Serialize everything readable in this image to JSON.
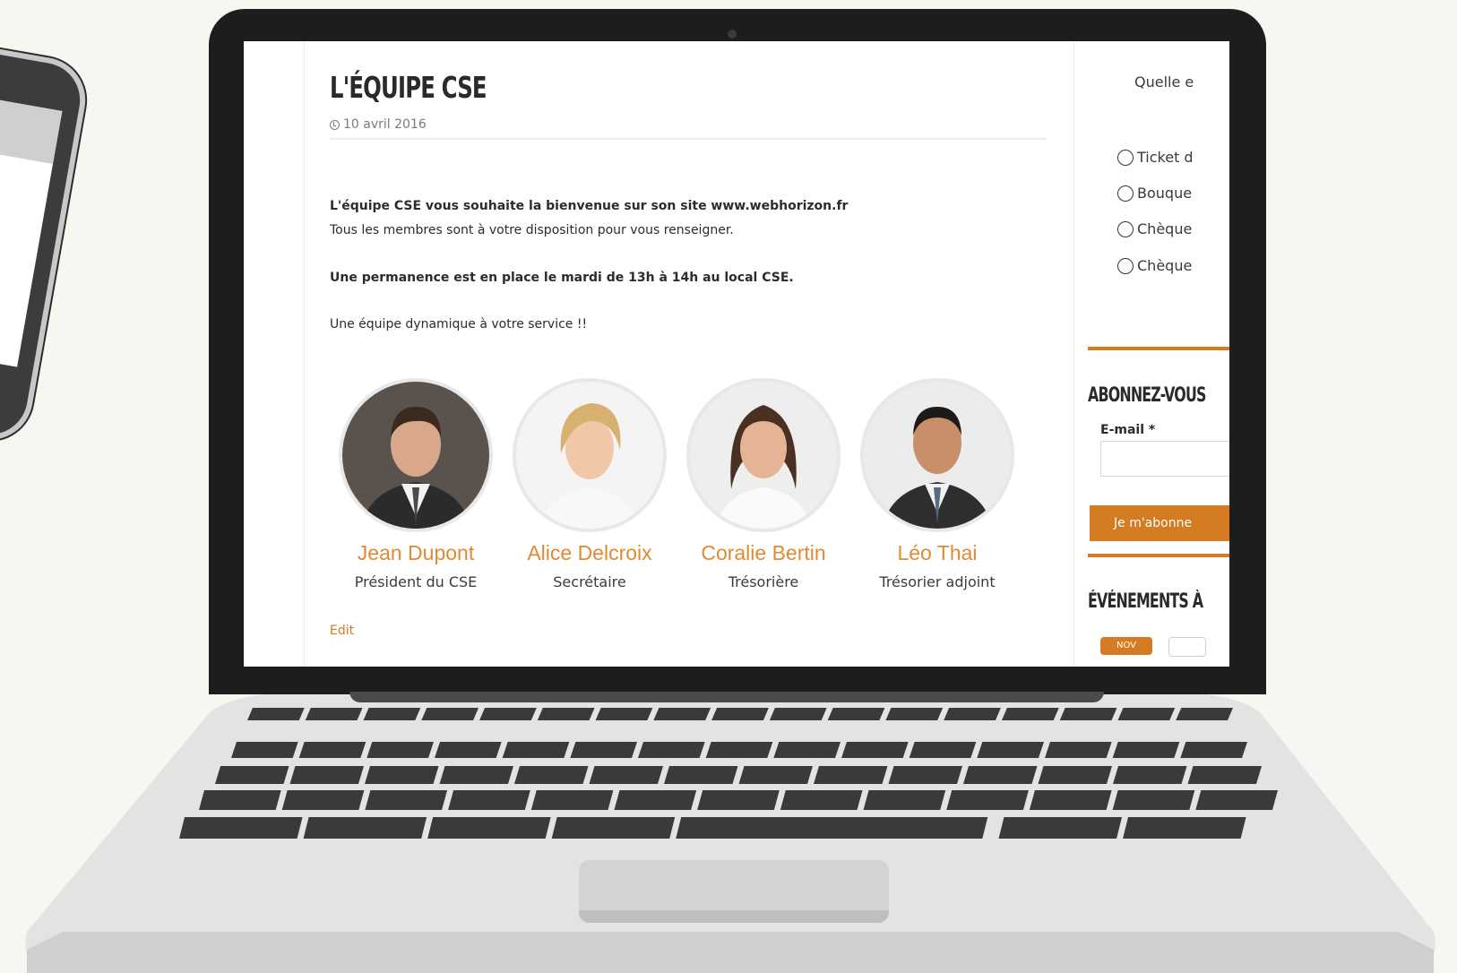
{
  "page": {
    "title": "L'ÉQUIPE CSE",
    "date": "10 avril 2016",
    "intro_bold": "L'équipe CSE vous souhaite la bienvenue sur son site www.webhorizon.fr",
    "intro_text": "Tous les membres sont à votre disposition pour vous renseigner.",
    "permanence": "Une permanence est en place le mardi de 13h à 14h au local CSE.",
    "tagline": "Une équipe dynamique à votre service !!",
    "edit_label": "Edit"
  },
  "team": [
    {
      "name": "Jean Dupont",
      "role": "Président du CSE"
    },
    {
      "name": "Alice Delcroix",
      "role": "Secrétaire"
    },
    {
      "name": "Coralie Bertin",
      "role": "Trésorière"
    },
    {
      "name": "Léo Thai",
      "role": "Trésorier adjoint"
    }
  ],
  "sidebar": {
    "poll_question": "Quelle e",
    "poll_options": [
      "Ticket d",
      "Bouque",
      "Chèque",
      "Chèque"
    ],
    "subscribe_title": "ABONNEZ-VOUS",
    "email_label": "E-mail *",
    "subscribe_button": "Je m'abonne",
    "events_title": "ÉVÉNEMENTS À",
    "events_month": "NOV"
  },
  "colors": {
    "accent": "#d57b22",
    "name_color": "#e08a34",
    "laptop_body": "#e6e6e6",
    "bezel": "#1d1d1d"
  }
}
